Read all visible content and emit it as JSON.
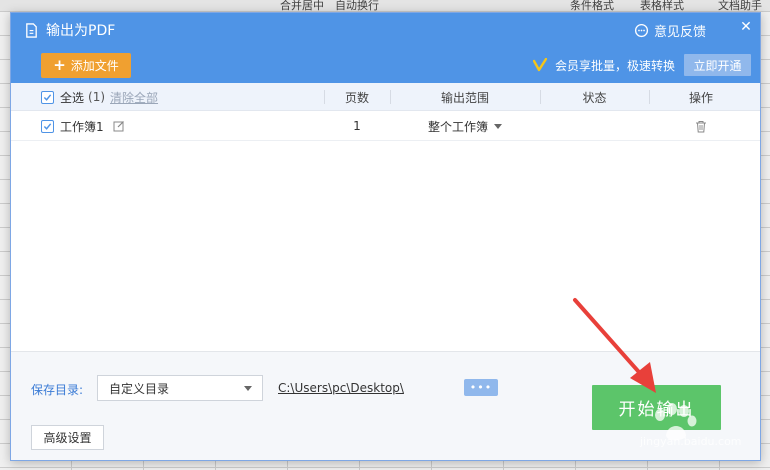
{
  "background_toolbar": [
    "合并居中",
    "自动换行",
    "条件格式",
    "表格样式",
    "文档助手"
  ],
  "dialog": {
    "title": "输出为PDF",
    "feedback_label": "意见反馈",
    "close_glyph": "✕",
    "add_file_label": "添加文件",
    "vip_text": "会员享批量，极速转换",
    "open_vip_label": "立即开通"
  },
  "table": {
    "select_all_label": "全选",
    "select_count": "(1)",
    "clear_all_label": "清除全部",
    "headers": {
      "pages": "页数",
      "range": "输出范围",
      "status": "状态",
      "action": "操作"
    },
    "rows": [
      {
        "name": "工作簿1",
        "pages": "1",
        "range": "整个工作簿",
        "status": "",
        "checked": true
      }
    ]
  },
  "footer": {
    "save_dir_label": "保存目录:",
    "dir_option": "自定义目录",
    "dir_path": "C:\\Users\\pc\\Desktop\\",
    "browse_label": "•••",
    "start_label": "开始输出",
    "advanced_label": "高级设置"
  },
  "watermark": {
    "text": "Baidu经验",
    "url_text": "jingyan.baidu.com"
  },
  "colors": {
    "header_blue": "#4f94e6",
    "add_orange": "#f0a030",
    "start_green": "#5cc56a",
    "arrow_red": "#e8403a"
  }
}
